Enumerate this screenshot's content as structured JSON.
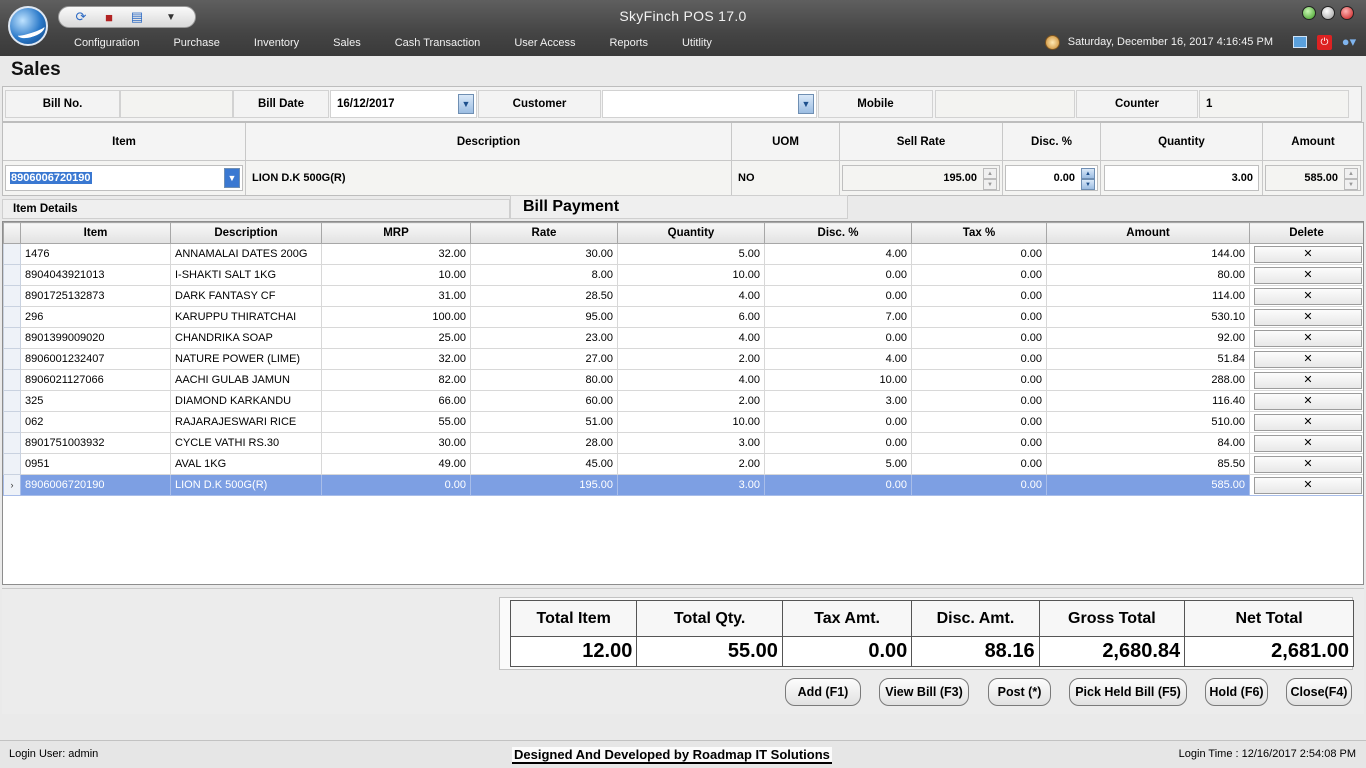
{
  "app": {
    "title": "SkyFinch  POS 17.0",
    "menu": [
      "Configuration",
      "Purchase",
      "Inventory",
      "Sales",
      "Cash Transaction",
      "User Access",
      "Reports",
      "Utitlity"
    ],
    "datetime": "Saturday, December 16, 2017 4:16:45 PM",
    "quick_icons": [
      "refresh-icon",
      "record-icon",
      "document-icon",
      "dropdown-icon"
    ]
  },
  "page": {
    "title": "Sales"
  },
  "header": {
    "bill_no_label": "Bill No.",
    "bill_no_value": "",
    "bill_date_label": "Bill Date",
    "bill_date_value": "16/12/2017",
    "customer_label": "Customer",
    "customer_value": "",
    "mobile_label": "Mobile",
    "mobile_value": "",
    "counter_label": "Counter",
    "counter_value": "1"
  },
  "entry": {
    "item_label": "Item",
    "description_label": "Description",
    "uom_label": "UOM",
    "sell_rate_label": "Sell Rate",
    "disc_label": "Disc. %",
    "quantity_label": "Quantity",
    "amount_label": "Amount",
    "item_value": "8906006720190",
    "description_value": "LION D.K 500G(R)",
    "uom_value": "NO",
    "sell_rate_value": "195.00",
    "disc_value": "0.00",
    "quantity_value": "3.00",
    "amount_value": "585.00"
  },
  "sections": {
    "item_details": "Item Details",
    "bill_payment": "Bill Payment"
  },
  "grid": {
    "columns": [
      "Item",
      "Description",
      "MRP",
      "Rate",
      "Quantity",
      "Disc. %",
      "Tax %",
      "Amount",
      "Delete"
    ],
    "delete_symbol": "✕",
    "selected_marker": "›",
    "rows": [
      [
        "1476",
        "ANNAMALAI DATES 200G",
        "32.00",
        "30.00",
        "5.00",
        "4.00",
        "0.00",
        "144.00"
      ],
      [
        "8904043921013",
        "I-SHAKTI SALT 1KG",
        "10.00",
        "8.00",
        "10.00",
        "0.00",
        "0.00",
        "80.00"
      ],
      [
        "8901725132873",
        "DARK FANTASY CF",
        "31.00",
        "28.50",
        "4.00",
        "0.00",
        "0.00",
        "114.00"
      ],
      [
        "296",
        "KARUPPU THIRATCHAI",
        "100.00",
        "95.00",
        "6.00",
        "7.00",
        "0.00",
        "530.10"
      ],
      [
        "8901399009020",
        "CHANDRIKA SOAP",
        "25.00",
        "23.00",
        "4.00",
        "0.00",
        "0.00",
        "92.00"
      ],
      [
        "8906001232407",
        "NATURE POWER (LIME)",
        "32.00",
        "27.00",
        "2.00",
        "4.00",
        "0.00",
        "51.84"
      ],
      [
        "8906021127066",
        "AACHI GULAB JAMUN",
        "82.00",
        "80.00",
        "4.00",
        "10.00",
        "0.00",
        "288.00"
      ],
      [
        "325",
        "DIAMOND KARKANDU",
        "66.00",
        "60.00",
        "2.00",
        "3.00",
        "0.00",
        "116.40"
      ],
      [
        "062",
        "RAJARAJESWARI RICE",
        "55.00",
        "51.00",
        "10.00",
        "0.00",
        "0.00",
        "510.00"
      ],
      [
        "8901751003932",
        "CYCLE VATHI RS.30",
        "30.00",
        "28.00",
        "3.00",
        "0.00",
        "0.00",
        "84.00"
      ],
      [
        "0951",
        "AVAL 1KG",
        "49.00",
        "45.00",
        "2.00",
        "5.00",
        "0.00",
        "85.50"
      ],
      [
        "8906006720190",
        "LION D.K 500G(R)",
        "0.00",
        "195.00",
        "3.00",
        "0.00",
        "0.00",
        "585.00"
      ]
    ],
    "selected_row_index": 11
  },
  "totals": {
    "labels": [
      "Total Item",
      "Total Qty.",
      "Tax Amt.",
      "Disc.  Amt.",
      "Gross Total",
      "Net Total"
    ],
    "values": [
      "12.00",
      "55.00",
      "0.00",
      "88.16",
      "2,680.84",
      "2,681.00"
    ]
  },
  "buttons": {
    "add": "Add (F1)",
    "view_bill": "View Bill (F3)",
    "post": "Post (*)",
    "pick_held_bill": "Pick Held Bill (F5)",
    "hold": "Hold (F6)",
    "close": "Close(F4)"
  },
  "status": {
    "login_user": "Login User: admin",
    "credit": "Designed And Developed by Roadmap IT Solutions",
    "login_time": "Login Time : 12/16/2017 2:54:08 PM"
  },
  "colors": {
    "selection": "#7d9fe3",
    "title_bar": "#4a4a4a",
    "dropdown_button": "#9cbde2"
  }
}
